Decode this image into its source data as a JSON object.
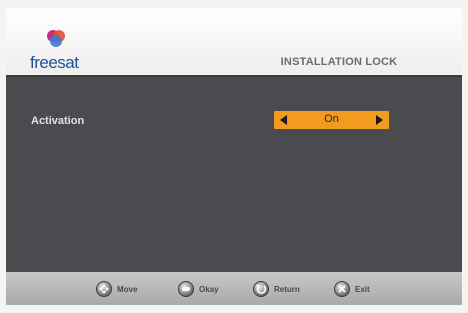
{
  "header": {
    "logo_text": "freesat",
    "title": "INSTALLATION LOCK"
  },
  "setting": {
    "label": "Activation",
    "value": "On"
  },
  "footer": {
    "buttons": [
      {
        "label": "Move",
        "icon": "dpad-icon"
      },
      {
        "label": "Okay",
        "icon": "ok-icon"
      },
      {
        "label": "Return",
        "icon": "return-icon"
      },
      {
        "label": "Exit",
        "icon": "exit-icon"
      }
    ]
  },
  "colors": {
    "accent": "#f29b1e",
    "panel": "#4a4b4e",
    "logo_blue": "#1f4f9c"
  }
}
